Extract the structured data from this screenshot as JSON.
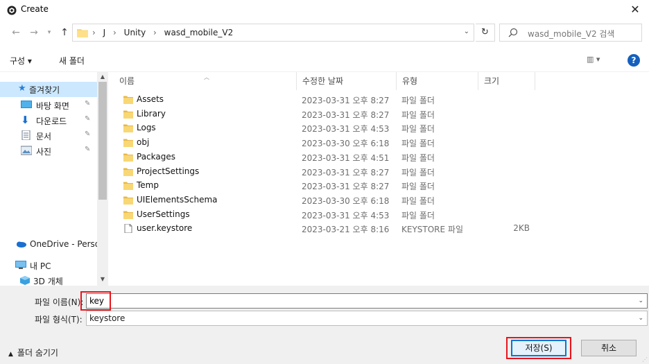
{
  "window": {
    "title": "Create",
    "close_glyph": "✕"
  },
  "address": {
    "segments": [
      "J",
      "Unity",
      "wasd_mobile_V2"
    ],
    "search_placeholder": "wasd_mobile_V2 검색"
  },
  "toolbar": {
    "organize_label": "구성 ▾",
    "new_folder_label": "새 폴더",
    "view_glyph": "▥ ▾",
    "help_glyph": "?"
  },
  "nav": {
    "quick_access": "즐겨찾기",
    "items": [
      {
        "label": "바탕 화면",
        "icon": "desktop-icon"
      },
      {
        "label": "다운로드",
        "icon": "download-icon"
      },
      {
        "label": "문서",
        "icon": "documents-icon"
      },
      {
        "label": "사진",
        "icon": "pictures-icon"
      }
    ],
    "onedrive": "OneDrive - Persor",
    "this_pc": "내 PC",
    "objects_3d": "3D 개체"
  },
  "columns": {
    "name": "이름",
    "modified": "수정한 날짜",
    "type": "유형",
    "size": "크기"
  },
  "files": [
    {
      "name": "Assets",
      "modified": "2023-03-31 오후 8:27",
      "type": "파일 폴더",
      "size": "",
      "kind": "folder"
    },
    {
      "name": "Library",
      "modified": "2023-03-31 오후 8:27",
      "type": "파일 폴더",
      "size": "",
      "kind": "folder"
    },
    {
      "name": "Logs",
      "modified": "2023-03-31 오후 4:53",
      "type": "파일 폴더",
      "size": "",
      "kind": "folder"
    },
    {
      "name": "obj",
      "modified": "2023-03-30 오후 6:18",
      "type": "파일 폴더",
      "size": "",
      "kind": "folder"
    },
    {
      "name": "Packages",
      "modified": "2023-03-31 오후 4:51",
      "type": "파일 폴더",
      "size": "",
      "kind": "folder"
    },
    {
      "name": "ProjectSettings",
      "modified": "2023-03-31 오후 8:27",
      "type": "파일 폴더",
      "size": "",
      "kind": "folder"
    },
    {
      "name": "Temp",
      "modified": "2023-03-31 오후 8:27",
      "type": "파일 폴더",
      "size": "",
      "kind": "folder"
    },
    {
      "name": "UIElementsSchema",
      "modified": "2023-03-30 오후 6:18",
      "type": "파일 폴더",
      "size": "",
      "kind": "folder"
    },
    {
      "name": "UserSettings",
      "modified": "2023-03-31 오후 4:53",
      "type": "파일 폴더",
      "size": "",
      "kind": "folder"
    },
    {
      "name": "user.keystore",
      "modified": "2023-03-21 오후 8:16",
      "type": "KEYSTORE 파일",
      "size": "2KB",
      "kind": "file"
    }
  ],
  "footer": {
    "filename_label": "파일 이름(N):",
    "filename_value": "key",
    "filetype_label": "파일 형식(T):",
    "filetype_value": "keystore",
    "hide_folders": "폴더 숨기기",
    "save_label": "저장(S)",
    "cancel_label": "취소"
  },
  "colors": {
    "highlight": "#e8141b",
    "accent": "#0078d7",
    "folder": "#f8d775",
    "selected": "#cce8ff"
  }
}
